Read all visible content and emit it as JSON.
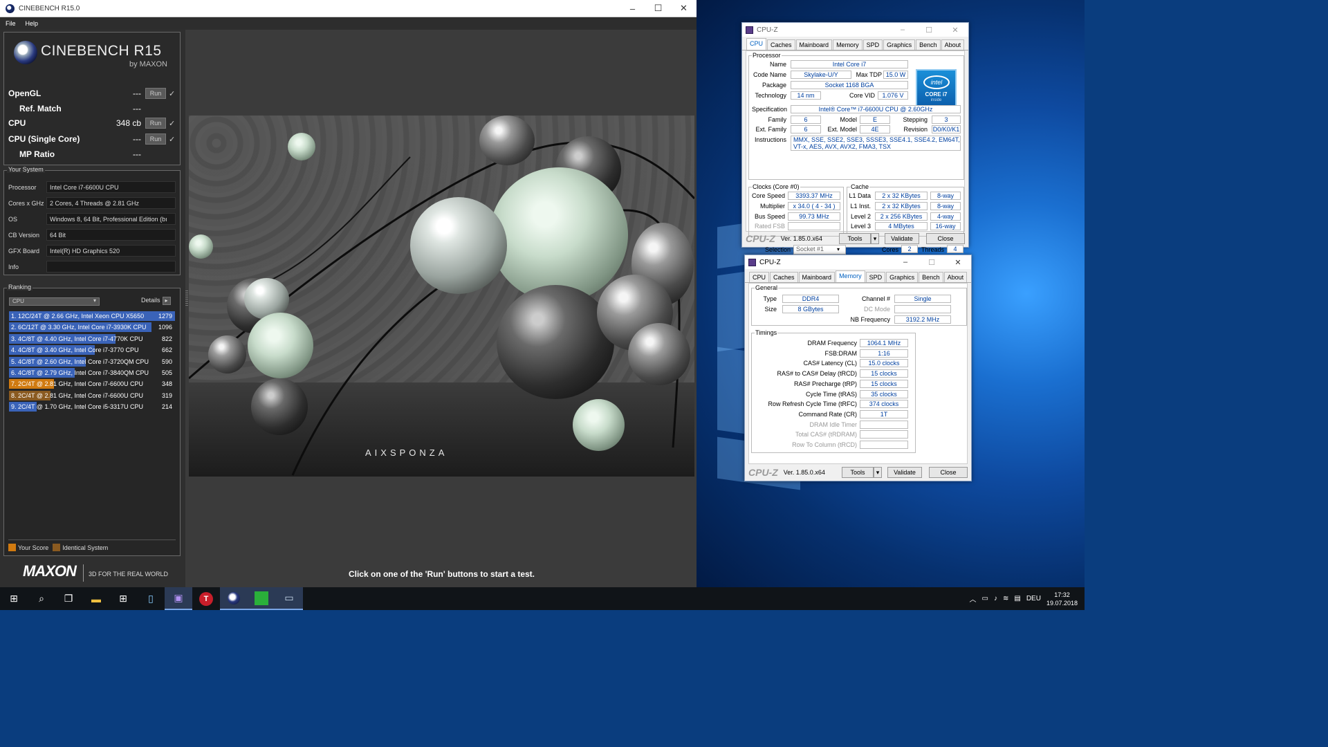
{
  "cinebench": {
    "window_title": "CINEBENCH R15.0",
    "menu": [
      "File",
      "Help"
    ],
    "logo_name": "CINEBENCH R15",
    "logo_by": "by MAXON",
    "tests": [
      {
        "label": "OpenGL",
        "value": "---",
        "run": "Run",
        "check": "✓"
      },
      {
        "label": "Ref. Match",
        "value": "---"
      },
      {
        "label": "CPU",
        "value": "348 cb",
        "run": "Run",
        "check": "✓"
      },
      {
        "label": "CPU (Single Core)",
        "value": "---",
        "run": "Run",
        "check": "✓"
      },
      {
        "label": "MP Ratio",
        "value": "---"
      }
    ],
    "your_system_title": "Your System",
    "system": [
      {
        "key": "Processor",
        "value": "Intel Core i7-6600U CPU"
      },
      {
        "key": "Cores x GHz",
        "value": "2 Cores, 4 Threads @ 2.81 GHz"
      },
      {
        "key": "OS",
        "value": "Windows 8, 64 Bit, Professional Edition (bı"
      },
      {
        "key": "CB Version",
        "value": "64 Bit"
      },
      {
        "key": "GFX Board",
        "value": "Intel(R) HD Graphics 520"
      },
      {
        "key": "Info",
        "value": ""
      }
    ],
    "ranking_title": "Ranking",
    "ranking_select": "CPU",
    "details_label": "Details",
    "ranking": [
      {
        "text": "1. 12C/24T @ 2.66 GHz, Intel Xeon CPU X5650",
        "score": "1279",
        "fraction": 1.0,
        "color": "#3a63b8"
      },
      {
        "text": "2. 6C/12T @ 3.30 GHz,  Intel Core i7-3930K CPU",
        "score": "1096",
        "fraction": 0.857,
        "color": "#3a63b8"
      },
      {
        "text": "3. 4C/8T @ 4.40 GHz, Intel Core i7-4770K CPU",
        "score": "822",
        "fraction": 0.643,
        "color": "#3a63b8"
      },
      {
        "text": "4. 4C/8T @ 3.40 GHz,  Intel Core i7-3770 CPU",
        "score": "662",
        "fraction": 0.518,
        "color": "#3a63b8"
      },
      {
        "text": "5. 4C/8T @ 2.60 GHz, Intel Core i7-3720QM CPU",
        "score": "590",
        "fraction": 0.461,
        "color": "#3a63b8"
      },
      {
        "text": "6. 4C/8T @ 2.79 GHz, Intel Core i7-3840QM CPU",
        "score": "505",
        "fraction": 0.395,
        "color": "#3a63b8"
      },
      {
        "text": "7. 2C/4T @ 2.81 GHz, Intel Core i7-6600U CPU",
        "score": "348",
        "fraction": 0.272,
        "color": "#d07a10"
      },
      {
        "text": "8. 2C/4T @ 2.81 GHz, Intel Core i7-6600U CPU",
        "score": "319",
        "fraction": 0.249,
        "color": "#8a5a20"
      },
      {
        "text": "9. 2C/4T @ 1.70 GHz, Intel Core i5-3317U CPU",
        "score": "214",
        "fraction": 0.167,
        "color": "#3a63b8"
      }
    ],
    "legend_your_score": "Your Score",
    "legend_identical": "Identical System",
    "legend_your_color": "#d07a10",
    "legend_identical_color": "#8a5a20",
    "maxon": "MAXON",
    "maxon_tag": "3D FOR THE REAL WORLD",
    "render_brand": "AIXSPONZA",
    "hint": "Click on one of the 'Run' buttons to start a test."
  },
  "cpuz1": {
    "title": "CPU-Z",
    "tabs": [
      "CPU",
      "Caches",
      "Mainboard",
      "Memory",
      "SPD",
      "Graphics",
      "Bench",
      "About"
    ],
    "active_tab": "CPU",
    "processor_group": "Processor",
    "name_label": "Name",
    "name": "Intel Core i7",
    "codename_label": "Code Name",
    "codename": "Skylake-U/Y",
    "maxtdp_label": "Max TDP",
    "maxtdp": "15.0 W",
    "package_label": "Package",
    "package": "Socket 1168 BGA",
    "technology_label": "Technology",
    "technology": "14 nm",
    "corevid_label": "Core VID",
    "corevid": "1.076 V",
    "spec_label": "Specification",
    "spec": "Intel® Core™ i7-6600U CPU @ 2.60GHz",
    "family_label": "Family",
    "family": "6",
    "model_label": "Model",
    "model": "E",
    "stepping_label": "Stepping",
    "stepping": "3",
    "extfamily_label": "Ext. Family",
    "extfamily": "6",
    "extmodel_label": "Ext. Model",
    "extmodel": "4E",
    "revision_label": "Revision",
    "revision": "D0/K0/K1",
    "instr_label": "Instructions",
    "instr": "MMX, SSE, SSE2, SSE3, SSSE3, SSE4.1, SSE4.2, EM64T, VT-x, AES, AVX, AVX2, FMA3, TSX",
    "intel_badge": "intel",
    "intel_core": "CORE i7",
    "intel_inside": "inside",
    "clocks_group": "Clocks (Core #0)",
    "corespeed_label": "Core Speed",
    "corespeed": "3393.37 MHz",
    "multiplier_label": "Multiplier",
    "multiplier": "x 34.0 ( 4 - 34 )",
    "busspeed_label": "Bus Speed",
    "busspeed": "99.73 MHz",
    "ratedfsb_label": "Rated FSB",
    "ratedfsb": "",
    "cache_group": "Cache",
    "l1d_label": "L1 Data",
    "l1d": "2 x 32 KBytes",
    "l1d_way": "8-way",
    "l1i_label": "L1 Inst.",
    "l1i": "2 x 32 KBytes",
    "l1i_way": "8-way",
    "l2_label": "Level 2",
    "l2": "2 x 256 KBytes",
    "l2_way": "4-way",
    "l3_label": "Level 3",
    "l3": "4 MBytes",
    "l3_way": "16-way",
    "selection_label": "Selection",
    "selection": "Socket #1",
    "cores_label": "Cores",
    "cores": "2",
    "threads_label": "Threads",
    "threads": "4",
    "brand": "CPU-Z",
    "version": "Ver. 1.85.0.x64",
    "tools": "Tools",
    "validate": "Validate",
    "close": "Close"
  },
  "cpuz2": {
    "title": "CPU-Z",
    "tabs": [
      "CPU",
      "Caches",
      "Mainboard",
      "Memory",
      "SPD",
      "Graphics",
      "Bench",
      "About"
    ],
    "active_tab": "Memory",
    "general_group": "General",
    "type_label": "Type",
    "type": "DDR4",
    "size_label": "Size",
    "size": "8 GBytes",
    "channel_label": "Channel #",
    "channel": "Single",
    "dcmode_label": "DC Mode",
    "dcmode": "",
    "nbfreq_label": "NB Frequency",
    "nbfreq": "3192.2 MHz",
    "timings_group": "Timings",
    "timings": [
      {
        "label": "DRAM Frequency",
        "value": "1064.1 MHz",
        "grey": false
      },
      {
        "label": "FSB:DRAM",
        "value": "1:16",
        "grey": false
      },
      {
        "label": "CAS# Latency (CL)",
        "value": "15.0 clocks",
        "grey": false
      },
      {
        "label": "RAS# to CAS# Delay (tRCD)",
        "value": "15 clocks",
        "grey": false
      },
      {
        "label": "RAS# Precharge (tRP)",
        "value": "15 clocks",
        "grey": false
      },
      {
        "label": "Cycle Time (tRAS)",
        "value": "35 clocks",
        "grey": false
      },
      {
        "label": "Row Refresh Cycle Time (tRFC)",
        "value": "374 clocks",
        "grey": false
      },
      {
        "label": "Command Rate (CR)",
        "value": "1T",
        "grey": false
      },
      {
        "label": "DRAM Idle Timer",
        "value": "",
        "grey": true
      },
      {
        "label": "Total CAS# (tRDRAM)",
        "value": "",
        "grey": true
      },
      {
        "label": "Row To Column (tRCD)",
        "value": "",
        "grey": true
      }
    ],
    "brand": "CPU-Z",
    "version": "Ver. 1.85.0.x64",
    "tools": "Tools",
    "validate": "Validate",
    "close": "Close"
  },
  "taskbar": {
    "icons": [
      "windows-start-icon",
      "search-icon",
      "task-view-icon",
      "file-explorer-icon",
      "store-icon",
      "notepad-icon",
      "cpuz-icon",
      "t-app-icon",
      "cinebench-icon",
      "green-app-icon",
      "monitor-app-icon"
    ],
    "lang": "DEU",
    "time": "17:32",
    "date": "19.07.2018"
  }
}
